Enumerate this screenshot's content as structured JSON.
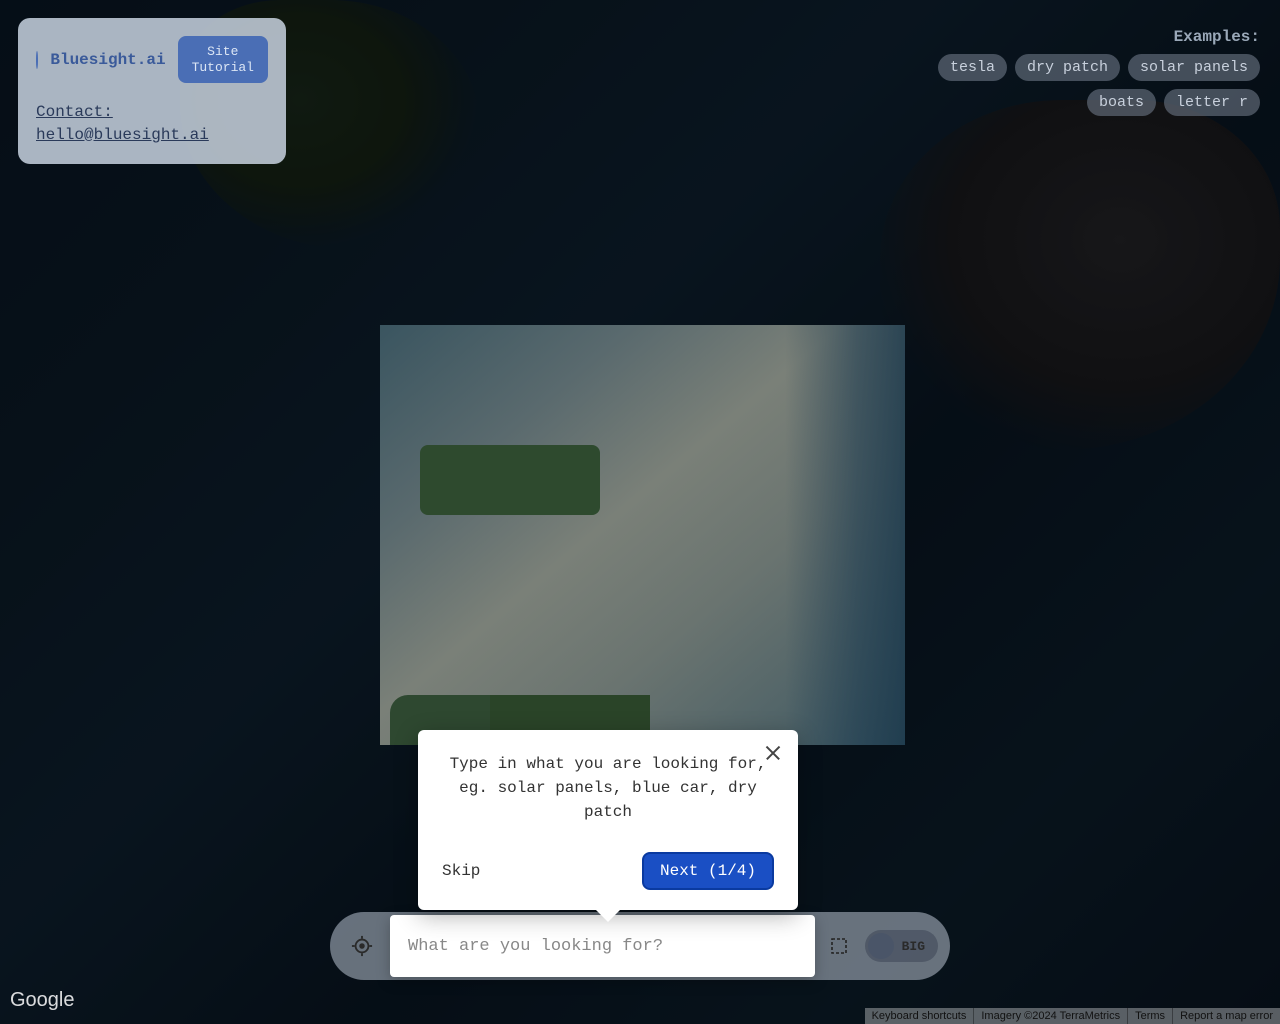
{
  "brand": {
    "name": "Bluesight.ai",
    "tutorial_button": "Site\nTutorial",
    "contact_label": "Contact:",
    "contact_email": "hello@bluesight.ai"
  },
  "examples": {
    "label": "Examples:",
    "chips_row1": [
      "tesla",
      "dry patch",
      "solar panels"
    ],
    "chips_row2": [
      "boats",
      "letter r"
    ]
  },
  "tutorial": {
    "text": "Type in what you are looking for, eg. solar panels, blue car, dry patch",
    "skip": "Skip",
    "next": "Next (1/4)"
  },
  "search": {
    "placeholder": "What are you looking for?",
    "toggle_label": "BIG"
  },
  "attribution": {
    "google": "Google",
    "items": [
      "Keyboard shortcuts",
      "Imagery ©2024 TerraMetrics",
      "Terms",
      "Report a map error"
    ]
  }
}
